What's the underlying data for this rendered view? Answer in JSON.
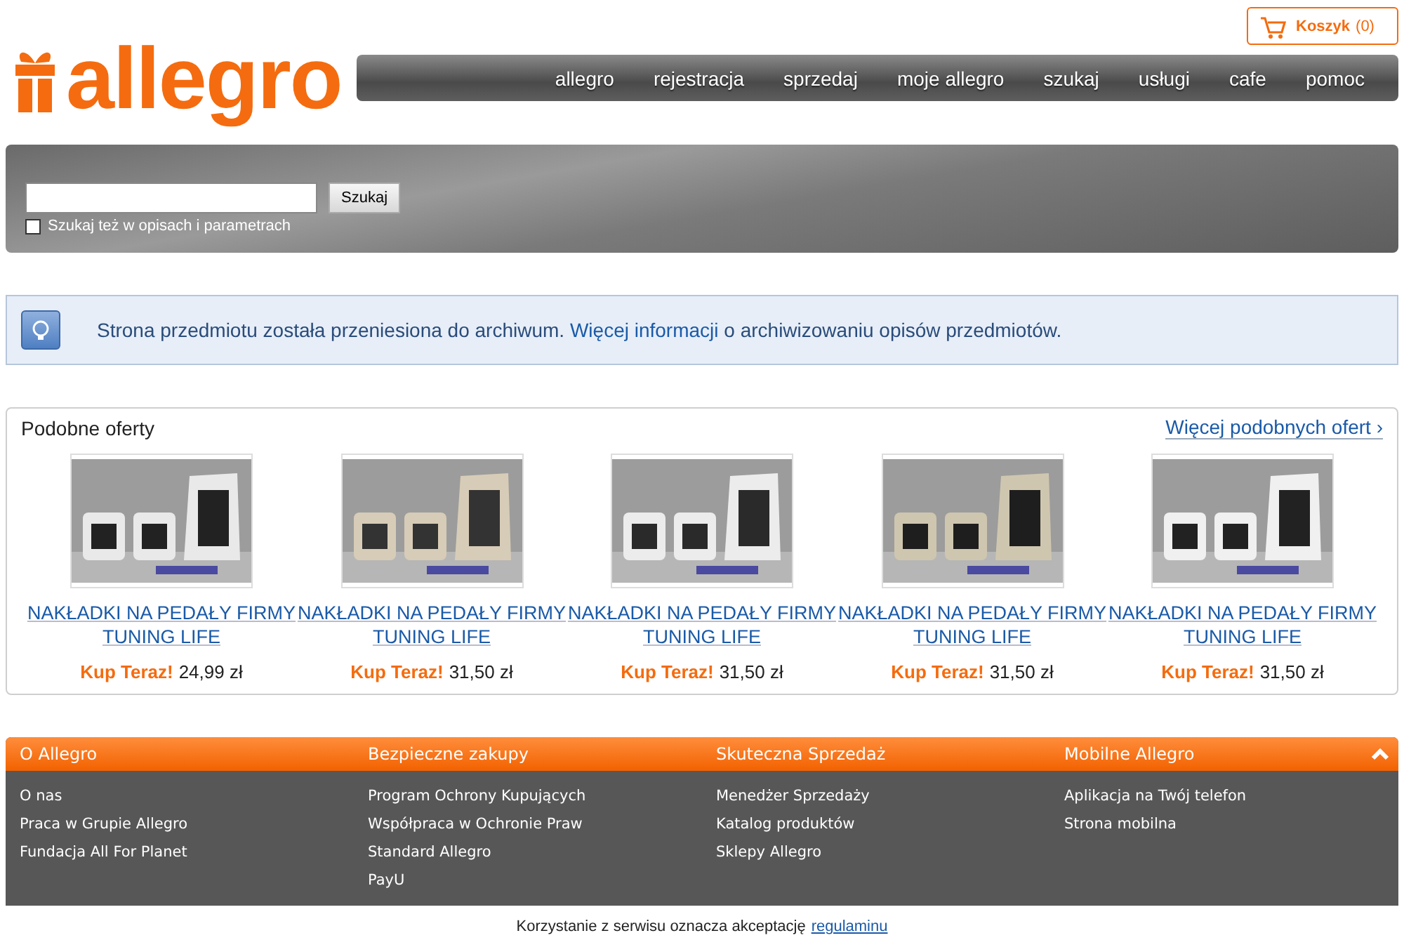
{
  "logo": {
    "text": "allegro"
  },
  "cart": {
    "label": "Koszyk",
    "count": "(0)"
  },
  "nav": [
    {
      "label": "allegro"
    },
    {
      "label": "rejestracja"
    },
    {
      "label": "sprzedaj"
    },
    {
      "label": "moje allegro"
    },
    {
      "label": "szukaj"
    },
    {
      "label": "usługi"
    },
    {
      "label": "cafe"
    },
    {
      "label": "pomoc"
    }
  ],
  "search": {
    "button": "Szukaj",
    "option": {
      "label": "Szukaj też w opisach i parametrach",
      "checked": false
    }
  },
  "notice": {
    "text_before": "Strona przedmiotu została przeniesiona do archiwum.",
    "link": "Więcej informacji",
    "text_after": "o archiwizowaniu opisów przedmiotów."
  },
  "similar": {
    "title": "Podobne oferty",
    "more_link": "Więcej podobnych ofert ›",
    "offers": [
      {
        "title": "NAKŁADKI NA PEDAŁY FIRMY TUNING LIFE",
        "buy_label": "Kup Teraz!",
        "price": "24,99 zł"
      },
      {
        "title": "NAKŁADKI NA PEDAŁY FIRMY TUNING LIFE",
        "buy_label": "Kup Teraz!",
        "price": "31,50 zł"
      },
      {
        "title": "NAKŁADKI NA PEDAŁY FIRMY TUNING LIFE",
        "buy_label": "Kup Teraz!",
        "price": "31,50 zł"
      },
      {
        "title": "NAKŁADKI NA PEDAŁY FIRMY TUNING LIFE",
        "buy_label": "Kup Teraz!",
        "price": "31,50 zł"
      },
      {
        "title": "NAKŁADKI NA PEDAŁY FIRMY TUNING LIFE",
        "buy_label": "Kup Teraz!",
        "price": "31,50 zł"
      }
    ]
  },
  "footer": {
    "columns": [
      {
        "heading": "O Allegro",
        "links": [
          "O nas",
          "Praca w Grupie Allegro",
          "Fundacja All For Planet"
        ]
      },
      {
        "heading": "Bezpieczne zakupy",
        "links": [
          "Program Ochrony Kupujących",
          "Współpraca w Ochronie Praw",
          "Standard Allegro",
          "PayU"
        ]
      },
      {
        "heading": "Skuteczna Sprzedaż",
        "links": [
          "Menedżer Sprzedaży",
          "Katalog produktów",
          "Sklepy Allegro"
        ]
      },
      {
        "heading": "Mobilne Allegro",
        "links": [
          "Aplikacja na Twój telefon",
          "Strona mobilna"
        ]
      }
    ],
    "terms_text": "Korzystanie z serwisu oznacza akceptację",
    "terms_link": "regulaminu"
  }
}
